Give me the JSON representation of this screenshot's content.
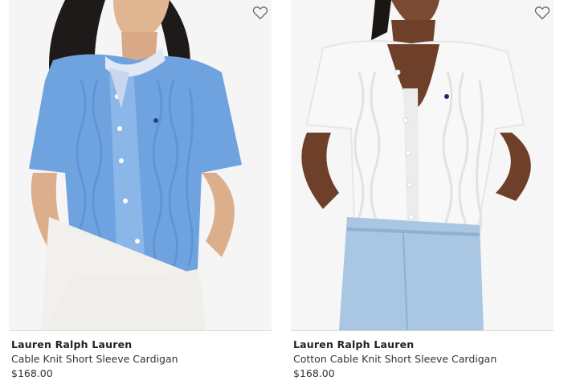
{
  "products": [
    {
      "brand": "Lauren Ralph Lauren",
      "name": "Cable Knit Short Sleeve Cardigan",
      "price": "$168.00",
      "color": "#6fa3e0"
    },
    {
      "brand": "Lauren Ralph Lauren",
      "name": "Cotton Cable Knit Short Sleeve Cardigan",
      "price": "$168.00",
      "color": "#f7f7f7"
    }
  ],
  "icons": {
    "wishlist": "heart-outline-icon"
  }
}
